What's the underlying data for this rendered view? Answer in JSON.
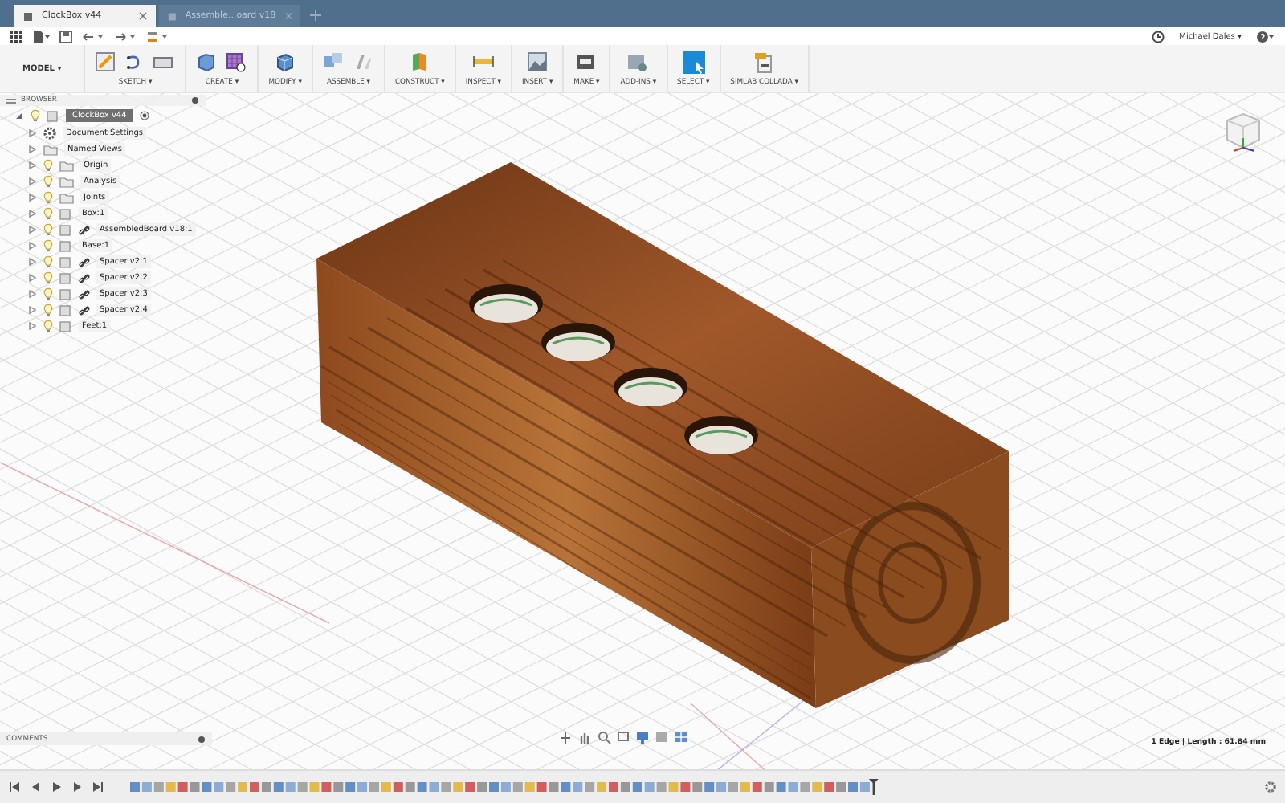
{
  "tabs": [
    {
      "label": "ClockBox v44",
      "selected": true
    },
    {
      "label": "Assemble...oard v18",
      "selected": false
    }
  ],
  "user": {
    "name": "Michael Dales ▾"
  },
  "workspace": {
    "label": "MODEL ▾"
  },
  "toolbar": [
    {
      "label": "SKETCH ▾",
      "kind": "sketch"
    },
    {
      "label": "CREATE ▾",
      "kind": "create"
    },
    {
      "label": "MODIFY ▾",
      "kind": "modify"
    },
    {
      "label": "ASSEMBLE ▾",
      "kind": "assemble"
    },
    {
      "label": "CONSTRUCT ▾",
      "kind": "construct"
    },
    {
      "label": "INSPECT ▾",
      "kind": "inspect"
    },
    {
      "label": "INSERT ▾",
      "kind": "insert"
    },
    {
      "label": "MAKE ▾",
      "kind": "make"
    },
    {
      "label": "ADD-INS ▾",
      "kind": "addins"
    },
    {
      "label": "SELECT ▾",
      "kind": "select"
    },
    {
      "label": "SIMLAB COLLADA ▾",
      "kind": "collada"
    }
  ],
  "browser": {
    "title": "BROWSER",
    "root": {
      "label": "ClockBox v44",
      "expanded": true,
      "active": true,
      "children": [
        {
          "label": "Document Settings",
          "kind": "settings",
          "expanded": false
        },
        {
          "label": "Named Views",
          "kind": "folder",
          "expanded": false
        },
        {
          "label": "Origin",
          "kind": "folder",
          "visible": true,
          "expanded": false
        },
        {
          "label": "Analysis",
          "kind": "folder",
          "visible": true,
          "expanded": false
        },
        {
          "label": "Joints",
          "kind": "folder",
          "visible": true,
          "expanded": false
        },
        {
          "label": "Box:1",
          "kind": "component",
          "visible": true,
          "linked": false,
          "expanded": false
        },
        {
          "label": "AssembledBoard v18:1",
          "kind": "component",
          "visible": true,
          "linked": true,
          "expanded": false
        },
        {
          "label": "Base:1",
          "kind": "component",
          "visible": true,
          "linked": false,
          "expanded": false
        },
        {
          "label": "Spacer v2:1",
          "kind": "component",
          "visible": true,
          "linked": true,
          "expanded": false
        },
        {
          "label": "Spacer v2:2",
          "kind": "component",
          "visible": true,
          "linked": true,
          "expanded": false
        },
        {
          "label": "Spacer v2:3",
          "kind": "component",
          "visible": true,
          "linked": true,
          "expanded": false
        },
        {
          "label": "Spacer v2:4",
          "kind": "component",
          "visible": true,
          "linked": true,
          "expanded": false
        },
        {
          "label": "Feet:1",
          "kind": "component",
          "visible": true,
          "linked": false,
          "expanded": false
        }
      ]
    }
  },
  "comments": {
    "title": "COMMENTS"
  },
  "status": {
    "text": "1 Edge | Length : 61.84 mm"
  }
}
